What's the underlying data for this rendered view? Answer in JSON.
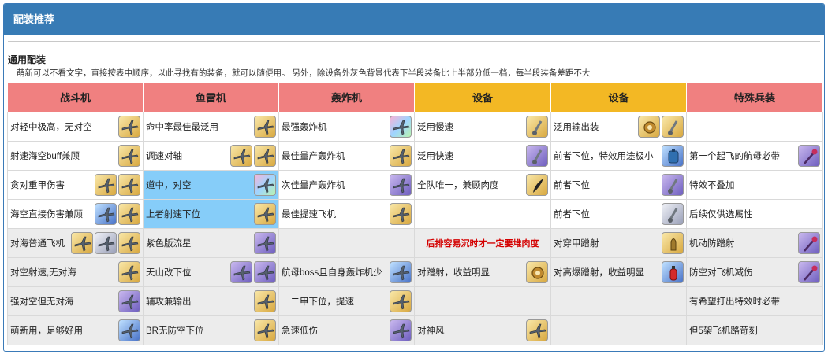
{
  "panel": {
    "title": "配装推荐"
  },
  "section": {
    "title": "通用配装",
    "desc": "萌新可以不看文字，直接按表中顺序，以此寻找有的装备，就可以随便用。 另外，除设备外灰色背景代表下半段装备比上半部分低一档，每半段装备差距不大"
  },
  "headers": [
    {
      "label": "战斗机",
      "color": "#f08080"
    },
    {
      "label": "鱼雷机",
      "color": "#f08080"
    },
    {
      "label": "轰炸机",
      "color": "#f08080"
    },
    {
      "label": "设备",
      "color": "#f3b824"
    },
    {
      "label": "设备",
      "color": "#f3b824"
    },
    {
      "label": "特殊兵装",
      "color": "#f08080"
    }
  ],
  "rows": [
    {
      "gray": false,
      "cells": [
        {
          "text": "对轻中极高，无对空",
          "icons": [
            "plane-icon:gold"
          ]
        },
        {
          "text": "命中率最佳最泛用",
          "icons": [
            "plane-icon:gold"
          ]
        },
        {
          "text": "最强轰炸机",
          "icons": [
            "plane-icon:rainbow"
          ]
        },
        {
          "text": "泛用慢速",
          "icons": [
            "catapult-icon:gold"
          ]
        },
        {
          "text": "泛用输出装",
          "icons": [
            "gear-icon:gold",
            "catapult-icon:gold"
          ]
        },
        {
          "text": "",
          "icons": []
        }
      ]
    },
    {
      "gray": false,
      "cells": [
        {
          "text": "射速海空buff兼顾",
          "icons": [
            "plane-icon:gold"
          ]
        },
        {
          "text": "调速对轴",
          "icons": [
            "plane-icon:gold",
            "plane-icon:gold"
          ]
        },
        {
          "text": "最佳量产轰炸机",
          "icons": [
            "plane-icon:gold"
          ]
        },
        {
          "text": "泛用快速",
          "icons": [
            "catapult-icon:purple"
          ]
        },
        {
          "text": "前者下位，特效用途极小",
          "icons": [
            "fuel-tank-icon:blue"
          ]
        },
        {
          "text": "第一个起飞的航母必带",
          "icons": [
            "staff-icon:purple"
          ]
        }
      ]
    },
    {
      "gray": false,
      "cells": [
        {
          "text": "贪对重甲伤害",
          "icons": [
            "plane-icon:gold",
            "plane-icon:gold"
          ]
        },
        {
          "text": "道中，对空",
          "icons": [
            "plane-icon:rainbow"
          ],
          "blue": true
        },
        {
          "text": "次佳量产轰炸机",
          "icons": [
            "plane-icon:purple"
          ]
        },
        {
          "text": "全队唯一，兼顾肉度",
          "icons": [
            "feather-icon:gold"
          ]
        },
        {
          "text": "前者下位",
          "icons": [
            "catapult-icon:purple"
          ]
        },
        {
          "text": "特效不叠加",
          "icons": []
        }
      ]
    },
    {
      "gray": false,
      "cells": [
        {
          "text": "海空直接伤害兼顾",
          "icons": [
            "plane-icon:blue",
            "plane-icon:gold"
          ]
        },
        {
          "text": "上者射速下位",
          "icons": [
            "plane-icon:gold"
          ],
          "blue": true
        },
        {
          "text": "最佳提速飞机",
          "icons": [
            "plane-icon:gold"
          ]
        },
        {
          "text": "",
          "icons": []
        },
        {
          "text": "前者下位",
          "icons": [
            "catapult-icon:silver"
          ]
        },
        {
          "text": "后续仅供选属性",
          "icons": []
        }
      ]
    },
    {
      "gray": true,
      "cells": [
        {
          "text": "对海普通飞机",
          "icons": [
            "plane-icon:gold",
            "plane-icon:silver",
            "plane-icon:gold"
          ]
        },
        {
          "text": "紫色版流星",
          "icons": [
            "plane-icon:purple"
          ]
        },
        {
          "text": "",
          "icons": []
        },
        {
          "text": "后排容易沉时才一定要堆肉度",
          "icons": [],
          "red": true
        },
        {
          "text": "对穿甲蹭射",
          "icons": [
            "shell-icon:gold"
          ]
        },
        {
          "text": "机动防蹭射",
          "icons": [
            "staff-icon:purple"
          ]
        }
      ]
    },
    {
      "gray": true,
      "cells": [
        {
          "text": "对空射速,无对海",
          "icons": [
            "plane-icon:gold"
          ]
        },
        {
          "text": "天山改下位",
          "icons": [
            "plane-icon:purple",
            "plane-icon:purple"
          ]
        },
        {
          "text": "航母boss且自身轰炸机少",
          "icons": [
            "plane-icon:blue"
          ]
        },
        {
          "text": "对蹭射，收益明显",
          "icons": [
            "gear-icon:gold"
          ]
        },
        {
          "text": "对高爆蹭射，收益明显",
          "icons": [
            "fire-extinguisher-icon:blue"
          ]
        },
        {
          "text": "防空对飞机减伤",
          "icons": [
            "staff-icon:purple"
          ]
        }
      ]
    },
    {
      "gray": true,
      "cells": [
        {
          "text": "强对空但无对海",
          "icons": [
            "plane-icon:purple"
          ]
        },
        {
          "text": "辅攻兼输出",
          "icons": [
            "plane-icon:gold"
          ]
        },
        {
          "text": "一二甲下位，提速",
          "icons": [
            "plane-icon:gold"
          ]
        },
        {
          "text": "",
          "icons": []
        },
        {
          "text": "",
          "icons": []
        },
        {
          "text": "有希望打出特效时必带",
          "icons": []
        }
      ]
    },
    {
      "gray": true,
      "cells": [
        {
          "text": "萌新用，足够好用",
          "icons": [
            "plane-icon:blue"
          ]
        },
        {
          "text": "BR无防空下位",
          "icons": [
            "plane-icon:gold"
          ]
        },
        {
          "text": "急速低伤",
          "icons": [
            "plane-icon:purple"
          ]
        },
        {
          "text": "对神风",
          "icons": [
            "plane-icon:gold"
          ]
        },
        {
          "text": "",
          "icons": []
        },
        {
          "text": "但5架飞机路苛刻",
          "icons": []
        }
      ]
    }
  ]
}
